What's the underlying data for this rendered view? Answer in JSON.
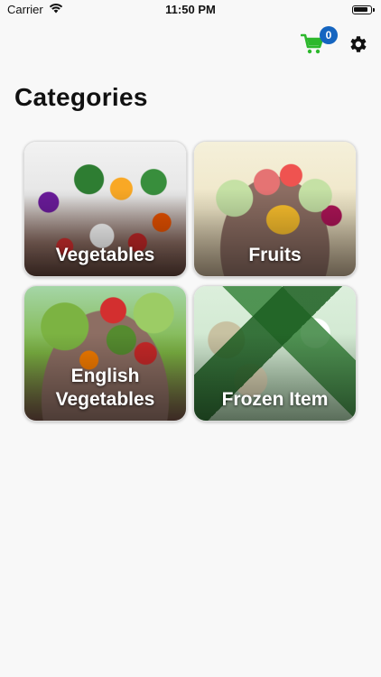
{
  "status_bar": {
    "carrier": "Carrier",
    "time": "11:50 PM",
    "battery_level_percent": 90
  },
  "nav": {
    "cart_icon": "shopping-cart-icon",
    "cart_color": "#2db82d",
    "cart_count": "0",
    "badge_color": "#1565c0",
    "settings_icon": "gear-icon"
  },
  "page": {
    "title": "Categories"
  },
  "categories": [
    {
      "label": "Vegetables"
    },
    {
      "label": "Fruits"
    },
    {
      "label": "English Vegetables"
    },
    {
      "label": "Frozen Item"
    }
  ]
}
